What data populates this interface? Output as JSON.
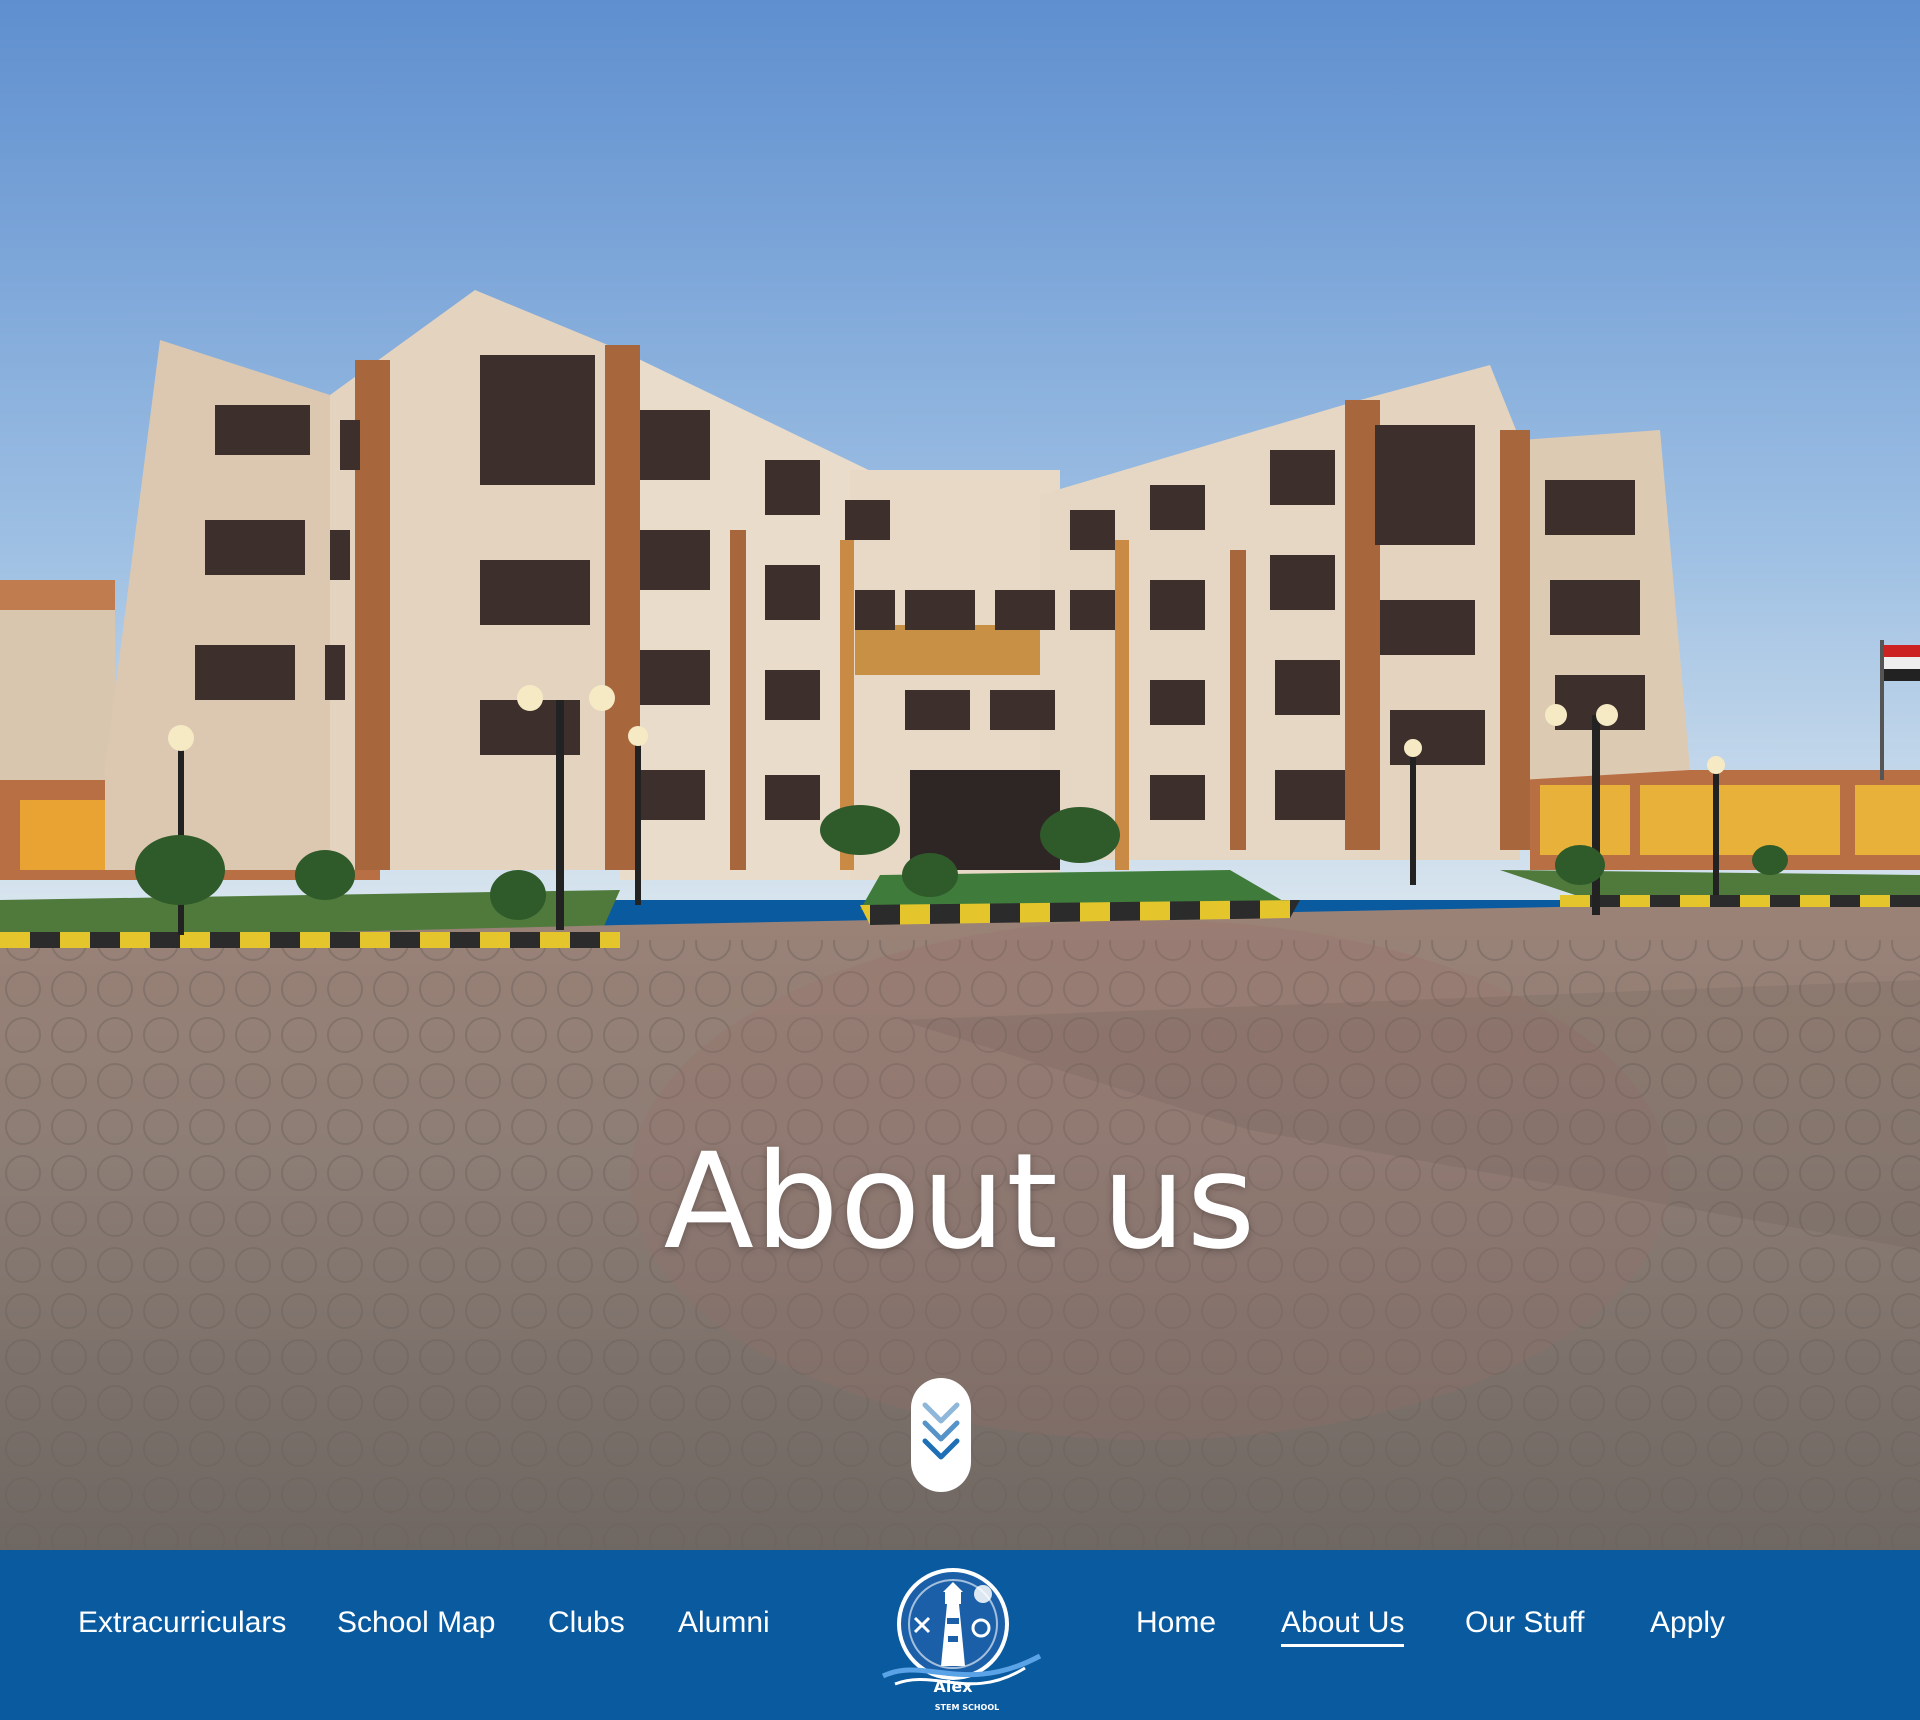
{
  "hero": {
    "title": "About us",
    "scroll_icon": "double-chevron-down-icon"
  },
  "nav": {
    "left_items": [
      {
        "label": "Extracurriculars"
      },
      {
        "label": "School Map"
      },
      {
        "label": "Clubs"
      },
      {
        "label": "Alumni"
      }
    ],
    "right_items": [
      {
        "label": "Home"
      },
      {
        "label": "About Us",
        "active": true
      },
      {
        "label": "Our Stuff"
      },
      {
        "label": "Apply"
      }
    ],
    "logo": {
      "icon": "alex-stem-school-logo",
      "text_main": "Alex",
      "text_sub": "STEM SCHOOL"
    }
  },
  "colors": {
    "nav_background": "#0a5aa0",
    "accent_blue": "#1e6fb5",
    "sky_top": "#6c9fd8",
    "paving": "#8a7c72"
  }
}
